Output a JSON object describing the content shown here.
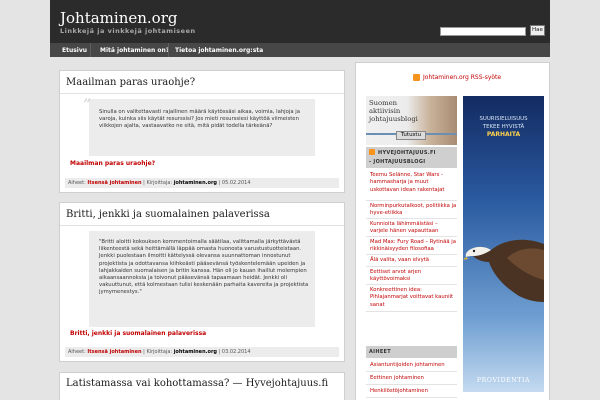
{
  "header": {
    "site_title": "Johtaminen.org",
    "site_description": "Linkkejä ja vinkkejä johtamiseen",
    "search_button": "Hae"
  },
  "nav": {
    "items": [
      {
        "label": "Etusivu"
      },
      {
        "label": "Mitä johtaminen on?"
      },
      {
        "label": "Tietoa johtaminen.org:sta"
      }
    ]
  },
  "posts": [
    {
      "title": "Maailman paras uraohje?",
      "excerpt": [
        "Sinulla on valitettavasti rajallinen määrä käytössäsi aikaa, voimia, lahjoja ja varoja, kuinka siis käytät resurssisi? Jos mieti resurssiesi käyttöä viimeisten viikkojen ajalta, vastaavatko ne sitä, mitä pidät todella tärkeänä?"
      ],
      "source_link": "Maailman paras uraohje?",
      "meta": {
        "categories_label": "Aiheet:",
        "category": "Itsensä johtaminen",
        "author_label": "Kirjoittaja:",
        "author": "johtaminen.org",
        "date": "05.02.2014"
      }
    },
    {
      "title": "Britti, jenkki ja suomalainen palaverissa",
      "excerpt": [
        "\"Britti aloitti kokouksen kommentoimalla säätilaa, valittamalla järkyttävästä liikenteestä sekä heittämällä läppää omasta huonosta varustustuotteistaan. Jenkki puolestaan ilmoitti kättelyssä olevansa suunnattoman innostunut projektista ja odottavansa kiihkeästi pääsevänsä työskentelemään upeiden ja lahjakkaiden suomalaisen ja britin kanssa. Hän oli jo kauan ihaillut molempien aikaansaannoksia ja toivonut pääsevänsä tapaamaan heidät. Jenkki oli vakuuttunut, että kolmestaan tulisi keskenään parhaita kavereita ja projektista jymymenestys.\""
      ],
      "source_link": "Britti, jenkki ja suomalainen palaverissa",
      "meta": {
        "categories_label": "Aiheet:",
        "category": "Itsensä johtaminen",
        "author_label": "Kirjoittaja:",
        "author": "johtaminen.org",
        "date": "03.02.2014"
      }
    },
    {
      "title": "Latistamassa vai kohottamassa? — Hyvejohtajuus.fi"
    }
  ],
  "sidebar": {
    "rss_link": "Johtaminen.org RSS-syöte",
    "ad_small": {
      "text": [
        "Suomen",
        "aktiivisin",
        "johtajuusblogi"
      ],
      "button": "Tutustu"
    },
    "blog_widget": {
      "title_lines": [
        "HYVEJOHTAJUUS.FI",
        "- JOHTAJUUSBLOGI"
      ],
      "items": [
        "Teemu Selänne, Star Wars - hammasharja ja muut uskottavan idean rakentajat",
        "Norminpurkutalkoot, politiikka ja hyve-etiikka",
        "Kunnioita lähimmäistäsi – varjele hänen vapauttaan",
        "Mad Max: Fury Road – Rytinää ja rikkinäisyyden filosofiaa",
        "Älä valita, vaan elvytä",
        "Eettiset arvot arjen käyttövoimaksi",
        "Konkreettinen idea: Pihlajanmarjat voittavat kauniit sanat"
      ]
    },
    "topics_widget": {
      "title": "AIHEET",
      "items": [
        "Asiantuntijoiden johtaminen",
        "Eettinen johtaminen",
        "Henkilöstöjohtaminen"
      ]
    },
    "ad_sky": {
      "lines": [
        "SUURISIELUISUUS",
        "TEKEE HYVISTÄ"
      ],
      "strong": "PARHAITA",
      "brand": "PROVIDENTIA"
    }
  },
  "colors": {
    "header_bg": "#2b2b2b",
    "nav_bg": "#474747",
    "link_red": "#c00000",
    "page_bg": "#e4e4e4"
  }
}
